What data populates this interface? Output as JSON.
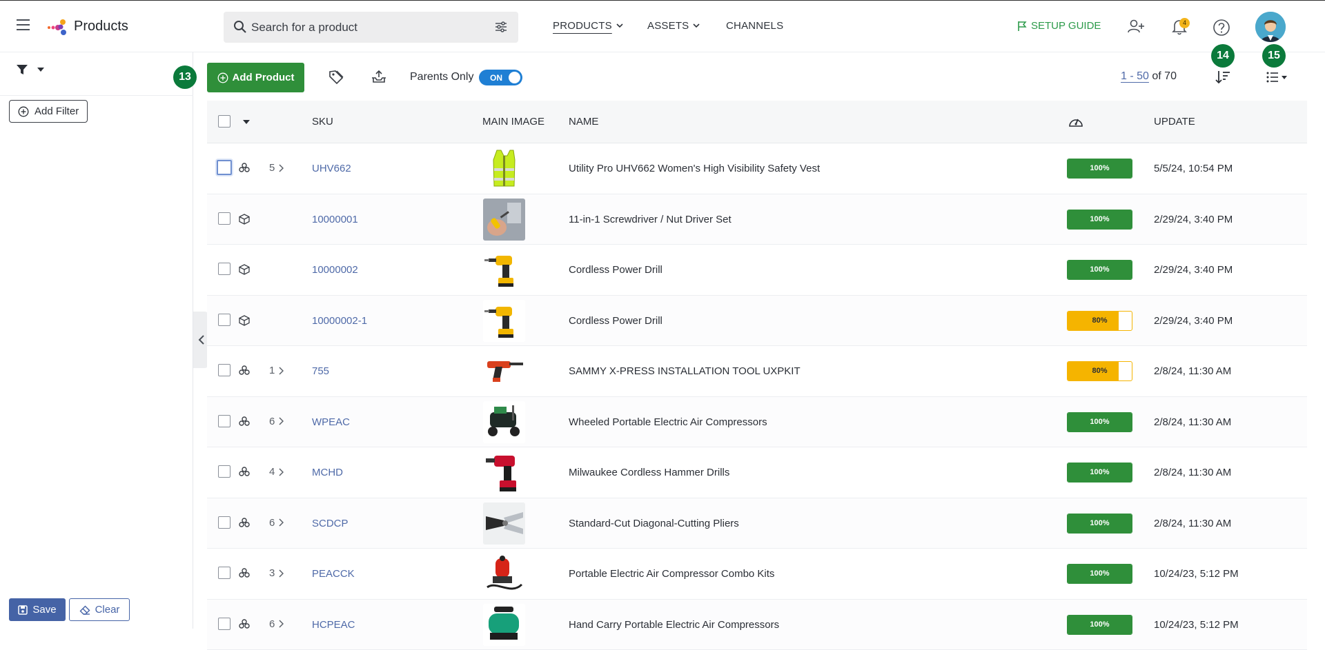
{
  "header": {
    "app_title": "Products",
    "search_placeholder": "Search for a product",
    "nav": [
      {
        "label": "PRODUCTS",
        "active": true
      },
      {
        "label": "ASSETS",
        "active": false
      },
      {
        "label": "CHANNELS",
        "active": false
      }
    ],
    "setup_guide": "SETUP GUIDE",
    "notification_count": "4",
    "icons": [
      "menu-icon",
      "logo-icon",
      "search-icon",
      "tune-icon",
      "flag-icon",
      "add-user-icon",
      "bell-icon",
      "help-icon",
      "avatar"
    ]
  },
  "filters": {
    "add_filter_label": "Add Filter",
    "save_label": "Save",
    "clear_label": "Clear"
  },
  "toolbar": {
    "badge_add": "13",
    "add_product_label": "Add Product",
    "parents_only_label": "Parents Only",
    "parents_only_state": "ON",
    "pager_range": "1 - 50",
    "pager_total": "of 70",
    "badge_sort": "14",
    "badge_view": "15"
  },
  "colors": {
    "primary_green": "#2f8f3a",
    "badge_green": "#0b7a3b",
    "score_yellow": "#f5b400",
    "link_blue": "#4f6aa8",
    "save_blue": "#4563a6",
    "toggle_blue": "#1f7fd4"
  },
  "table": {
    "headers": {
      "sku": "SKU",
      "main_image": "MAIN IMAGE",
      "name": "NAME",
      "update": "UPDATE"
    },
    "rows": [
      {
        "type": "parent",
        "children": "5",
        "sku": "UHV662",
        "image": "safety-vest",
        "name": "Utility Pro UHV662 Women's High Visibility Safety Vest",
        "score": "100%",
        "score_value": 100,
        "updated": "5/5/24, 10:54 PM"
      },
      {
        "type": "single",
        "children": "",
        "sku": "10000001",
        "image": "screwdriver",
        "name": "11-in-1 Screwdriver / Nut Driver Set",
        "score": "100%",
        "score_value": 100,
        "updated": "2/29/24, 3:40 PM"
      },
      {
        "type": "single",
        "children": "",
        "sku": "10000002",
        "image": "drill",
        "name": "Cordless Power Drill",
        "score": "100%",
        "score_value": 100,
        "updated": "2/29/24, 3:40 PM"
      },
      {
        "type": "single",
        "children": "",
        "sku": "10000002-1",
        "image": "drill",
        "name": "Cordless Power Drill",
        "score": "80%",
        "score_value": 80,
        "updated": "2/29/24, 3:40 PM"
      },
      {
        "type": "parent",
        "children": "1",
        "sku": "755",
        "image": "install-tool",
        "name": "SAMMY X-PRESS INSTALLATION TOOL UXPKIT",
        "score": "80%",
        "score_value": 80,
        "updated": "2/8/24, 11:30 AM"
      },
      {
        "type": "parent",
        "children": "6",
        "sku": "WPEAC",
        "image": "compressor",
        "name": "Wheeled Portable Electric Air Compressors",
        "score": "100%",
        "score_value": 100,
        "updated": "2/8/24, 11:30 AM"
      },
      {
        "type": "parent",
        "children": "4",
        "sku": "MCHD",
        "image": "hammer-drill",
        "name": "Milwaukee Cordless Hammer Drills",
        "score": "100%",
        "score_value": 100,
        "updated": "2/8/24, 11:30 AM"
      },
      {
        "type": "parent",
        "children": "6",
        "sku": "SCDCP",
        "image": "pliers",
        "name": "Standard-Cut Diagonal-Cutting Pliers",
        "score": "100%",
        "score_value": 100,
        "updated": "2/8/24, 11:30 AM"
      },
      {
        "type": "parent",
        "children": "3",
        "sku": "PEACCK",
        "image": "combo-kit",
        "name": "Portable Electric Air Compressor Combo Kits",
        "score": "100%",
        "score_value": 100,
        "updated": "10/24/23, 5:12 PM"
      },
      {
        "type": "parent",
        "children": "6",
        "sku": "HCPEAC",
        "image": "hand-compressor",
        "name": "Hand Carry Portable Electric Air Compressors",
        "score": "100%",
        "score_value": 100,
        "updated": "10/24/23, 5:12 PM"
      }
    ]
  }
}
